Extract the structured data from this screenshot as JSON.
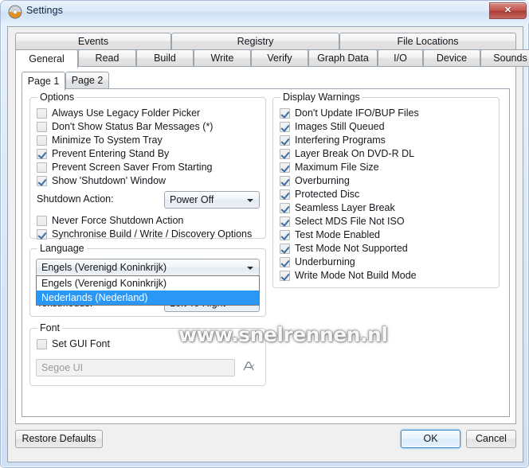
{
  "window": {
    "title": "Settings",
    "icon": "disc-icon",
    "close_label": "✕"
  },
  "tabs_row1": [
    {
      "label": "Events"
    },
    {
      "label": "Registry"
    },
    {
      "label": "File Locations"
    }
  ],
  "tabs_row2": [
    {
      "label": "General",
      "active": true
    },
    {
      "label": "Read"
    },
    {
      "label": "Build"
    },
    {
      "label": "Write"
    },
    {
      "label": "Verify"
    },
    {
      "label": "Graph Data"
    },
    {
      "label": "I/O"
    },
    {
      "label": "Device"
    },
    {
      "label": "Sounds"
    }
  ],
  "inner_tabs": [
    {
      "label": "Page 1",
      "active": true
    },
    {
      "label": "Page 2"
    }
  ],
  "options": {
    "title": "Options",
    "items": [
      {
        "label": "Always Use Legacy Folder Picker",
        "checked": false
      },
      {
        "label": "Don't Show Status Bar Messages (*)",
        "checked": false
      },
      {
        "label": "Minimize To System Tray",
        "checked": false
      },
      {
        "label": "Prevent Entering Stand By",
        "checked": true
      },
      {
        "label": "Prevent Screen Saver From Starting",
        "checked": false
      },
      {
        "label": "Show 'Shutdown' Window",
        "checked": true
      }
    ],
    "shutdown_action_label": "Shutdown Action:",
    "shutdown_action_value": "Power Off",
    "items2": [
      {
        "label": "Never Force Shutdown Action",
        "checked": false
      },
      {
        "label": "Synchronise Build / Write / Discovery Options",
        "checked": true
      }
    ]
  },
  "display_warnings": {
    "title": "Display Warnings",
    "items": [
      {
        "label": "Don't Update IFO/BUP Files",
        "checked": true
      },
      {
        "label": "Images Still Queued",
        "checked": true
      },
      {
        "label": "Interfering Programs",
        "checked": true
      },
      {
        "label": "Layer Break On DVD-R DL",
        "checked": true
      },
      {
        "label": "Maximum File Size",
        "checked": true
      },
      {
        "label": "Overburning",
        "checked": true
      },
      {
        "label": "Protected Disc",
        "checked": true
      },
      {
        "label": "Seamless Layer Break",
        "checked": true
      },
      {
        "label": "Select MDS File Not ISO",
        "checked": true
      },
      {
        "label": "Test Mode Enabled",
        "checked": true
      },
      {
        "label": "Test Mode Not Supported",
        "checked": true
      },
      {
        "label": "Underburning",
        "checked": true
      },
      {
        "label": "Write Mode Not Build Mode",
        "checked": true
      }
    ]
  },
  "language": {
    "title": "Language",
    "selected": "Engels (Verenigd Koninkrijk)",
    "open": true,
    "options": [
      {
        "label": "Engels (Verenigd Koninkrijk)",
        "selected": false
      },
      {
        "label": "Nederlands (Nederland)",
        "selected": true
      }
    ],
    "text_mode_label": "Tekstmodus:",
    "text_mode_value": "Left To Right"
  },
  "font": {
    "title": "Font",
    "set_gui_font_label": "Set GUI Font",
    "set_gui_font_checked": false,
    "font_value": "Segoe UI",
    "picker_icon": "font-picker-icon"
  },
  "watermark": {
    "text": "www.snelrennen.nl"
  },
  "footer": {
    "restore_defaults": "Restore Defaults",
    "ok": "OK",
    "cancel": "Cancel"
  }
}
